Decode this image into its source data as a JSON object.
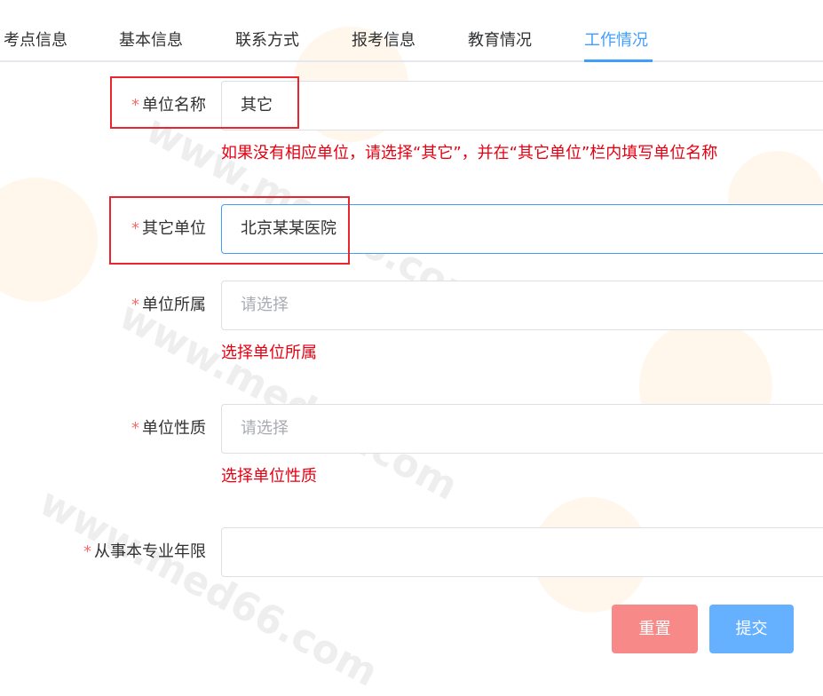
{
  "tabs": [
    {
      "label": "考点信息",
      "active": false
    },
    {
      "label": "基本信息",
      "active": false
    },
    {
      "label": "联系方式",
      "active": false
    },
    {
      "label": "报考信息",
      "active": false
    },
    {
      "label": "教育情况",
      "active": false
    },
    {
      "label": "工作情况",
      "active": true
    }
  ],
  "form": {
    "required_mark": "*",
    "unit_name": {
      "label": "单位名称",
      "value": "其它",
      "hint": "如果没有相应单位，请选择“其它”，并在“其它单位”栏内填写单位名称"
    },
    "other_unit": {
      "label": "其它单位",
      "value": "北京某某医院"
    },
    "unit_affiliation": {
      "label": "单位所属",
      "placeholder": "请选择",
      "hint": "选择单位所属"
    },
    "unit_nature": {
      "label": "单位性质",
      "placeholder": "请选择",
      "hint": "选择单位性质"
    },
    "years_in_profession": {
      "label": "从事本专业年限",
      "value": ""
    }
  },
  "buttons": {
    "reset": "重置",
    "submit": "提交"
  },
  "colors": {
    "accent": "#409eff",
    "required": "#f56c6c",
    "hint": "#e60012",
    "highlight": "#e8262d",
    "reset_button": "#f78989",
    "submit_button": "#66b1ff"
  }
}
